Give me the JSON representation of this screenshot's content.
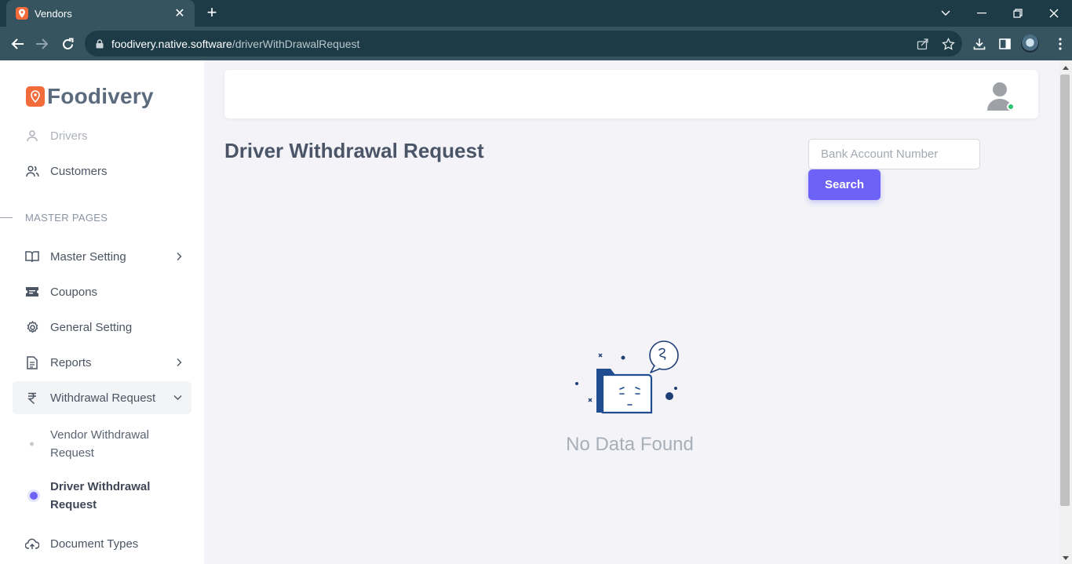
{
  "browser": {
    "tab_title": "Vendors",
    "url_host": "foodivery.native.software",
    "url_path": "/driverWithDrawalRequest"
  },
  "brand": {
    "name": "Foodivery"
  },
  "sidebar": {
    "items_top": [
      {
        "label": "Drivers",
        "icon": "user-icon"
      },
      {
        "label": "Customers",
        "icon": "users-icon"
      }
    ],
    "section_label": "MASTER PAGES",
    "items": [
      {
        "label": "Master Setting",
        "icon": "book-icon"
      },
      {
        "label": "Coupons",
        "icon": "ticket-icon"
      },
      {
        "label": "General Setting",
        "icon": "gear-icon"
      },
      {
        "label": "Reports",
        "icon": "document-icon"
      },
      {
        "label": "Withdrawal Request",
        "icon": "rupee-icon"
      }
    ],
    "subitems": [
      {
        "label": "Vendor Withdrawal Request"
      },
      {
        "label": "Driver Withdrawal Request"
      }
    ],
    "items_bottom": [
      {
        "label": "Document Types",
        "icon": "cloud-upload-icon"
      }
    ]
  },
  "main": {
    "title": "Driver Withdrawal Request",
    "search_placeholder": "Bank Account Number",
    "search_button": "Search",
    "empty_text": "No Data Found"
  },
  "colors": {
    "accent": "#6c63f6",
    "brand": "#f26b3a",
    "chrome_dark": "#1d3b47",
    "chrome": "#35545f",
    "online": "#28c76f"
  }
}
